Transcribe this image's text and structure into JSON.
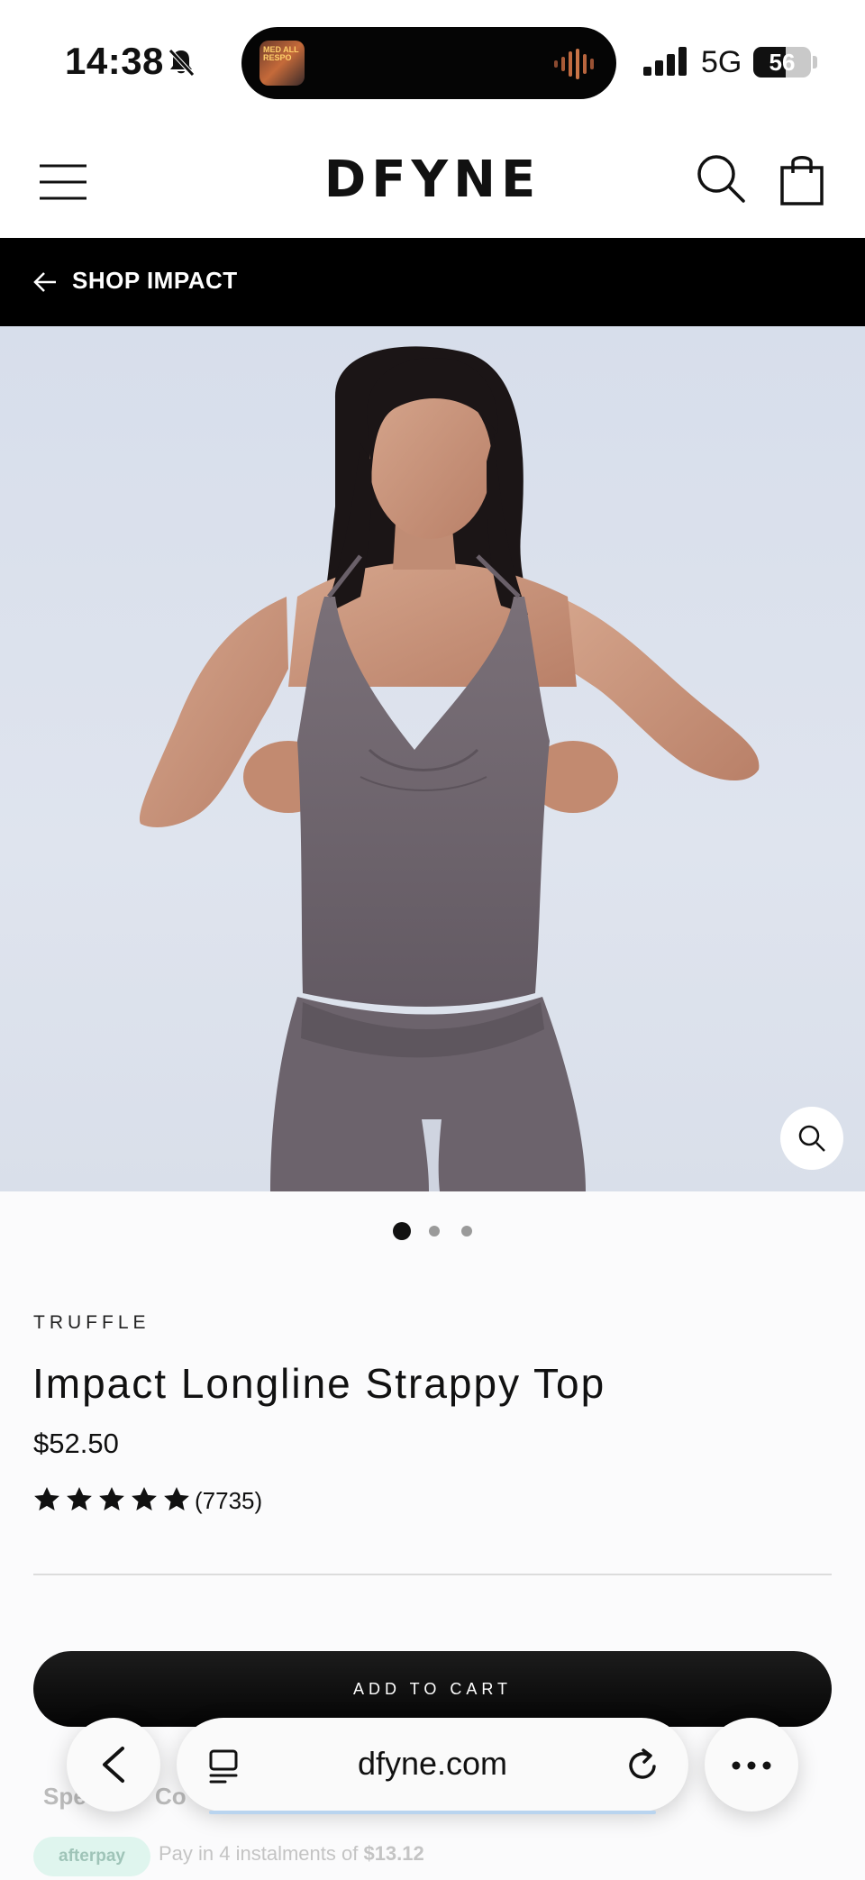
{
  "status_bar": {
    "time": "14:38",
    "island_art_text": "MED ALL RESPO",
    "network": "5G",
    "battery": "56",
    "battery_level": 0.56
  },
  "header": {
    "logo": "DFYNE",
    "icons": [
      "menu-icon",
      "search-icon",
      "bag-icon"
    ]
  },
  "back_bar": {
    "label": "SHOP IMPACT"
  },
  "gallery": {
    "slides": 3,
    "active_index": 0
  },
  "product": {
    "color": "TRUFFLE",
    "title": "Impact Longline Strappy Top",
    "price": "$52.50",
    "rating_stars": 5,
    "review_count": "(7735)",
    "add_to_cart": "ADD TO CART"
  },
  "below_fold": {
    "tab_1": "Spe",
    "tab_2": "Co",
    "afterpay_badge": "afterpay",
    "afterpay_text": "Pay in 4 instalments of ",
    "afterpay_amount": "$13.12"
  },
  "browser": {
    "url": "dfyne.com"
  },
  "colors": {
    "accent": "#000000",
    "background": "#fbfbfc",
    "photo_backdrop": "#dbe1ec",
    "garment": "#6e6570"
  }
}
